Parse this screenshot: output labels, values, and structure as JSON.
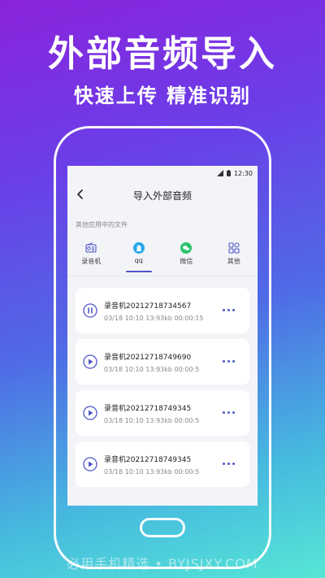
{
  "promo": {
    "headline": "外部音频导入",
    "subline": "快速上传 精准识别"
  },
  "status_bar": {
    "time": "12:30"
  },
  "nav": {
    "title": "导入外部音频"
  },
  "section_label": "其他应用中的文件",
  "tabs": [
    {
      "label": "录音机",
      "icon": "radio-icon"
    },
    {
      "label": "qq",
      "icon": "qq-icon",
      "active": true
    },
    {
      "label": "微信",
      "icon": "wechat-icon"
    },
    {
      "label": "其他",
      "icon": "grid-icon"
    }
  ],
  "files": [
    {
      "name": "录音机20212718734567",
      "meta": "03/18 10:10   13:93kb  00:00:15",
      "state": "paused"
    },
    {
      "name": "录音机20212718749690",
      "meta": "03/18 10:10   13:93kb  00:00:5",
      "state": "play"
    },
    {
      "name": "录音机20212718749345",
      "meta": "03/18 10:10   13:93kb  00:00:5",
      "state": "play"
    },
    {
      "name": "录音机20212718749345",
      "meta": "03/18 10:10   13:93kb  00:00:5",
      "state": "play"
    }
  ],
  "watermark": "必用手机精选 • BYJSJXY.COM",
  "colors": {
    "accent": "#4d56c8",
    "qq": "#2aa7e8",
    "wechat": "#2ec36b"
  }
}
